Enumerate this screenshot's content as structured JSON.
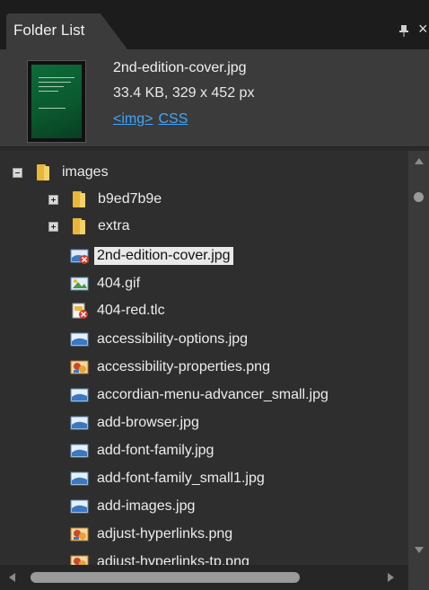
{
  "panel": {
    "title": "Folder List"
  },
  "preview": {
    "file_name": "2nd-edition-cover.jpg",
    "file_info": "33.4 KB, 329 x 452 px",
    "link_img": "<img>",
    "link_css": "CSS"
  },
  "tree": {
    "root": {
      "label": "images",
      "icon": "folder-icon"
    },
    "folders": [
      {
        "label": "b9ed7b9e",
        "icon": "folder-icon"
      },
      {
        "label": "extra",
        "icon": "folder-icon"
      }
    ],
    "files": [
      {
        "label": "2nd-edition-cover.jpg",
        "icon": "image-error-icon",
        "selected": true
      },
      {
        "label": "404.gif",
        "icon": "gif-image-icon"
      },
      {
        "label": "404-red.tlc",
        "icon": "template-error-icon"
      },
      {
        "label": "accessibility-options.jpg",
        "icon": "image-file-icon"
      },
      {
        "label": "accessibility-properties.png",
        "icon": "png-image-icon"
      },
      {
        "label": "accordian-menu-advancer_small.jpg",
        "icon": "image-file-icon"
      },
      {
        "label": "add-browser.jpg",
        "icon": "image-file-icon"
      },
      {
        "label": "add-font-family.jpg",
        "icon": "image-file-icon"
      },
      {
        "label": "add-font-family_small1.jpg",
        "icon": "image-file-icon"
      },
      {
        "label": "add-images.jpg",
        "icon": "image-file-icon"
      },
      {
        "label": "adjust-hyperlinks.png",
        "icon": "png-image-icon"
      },
      {
        "label": "adjust-hyperlinks-tp.png",
        "icon": "png-image-icon"
      }
    ]
  },
  "colors": {
    "panel_bg": "#2e2e2e",
    "header_bg": "#3b3b3b",
    "link": "#3ea6ff",
    "folder": "#e8b73a"
  }
}
